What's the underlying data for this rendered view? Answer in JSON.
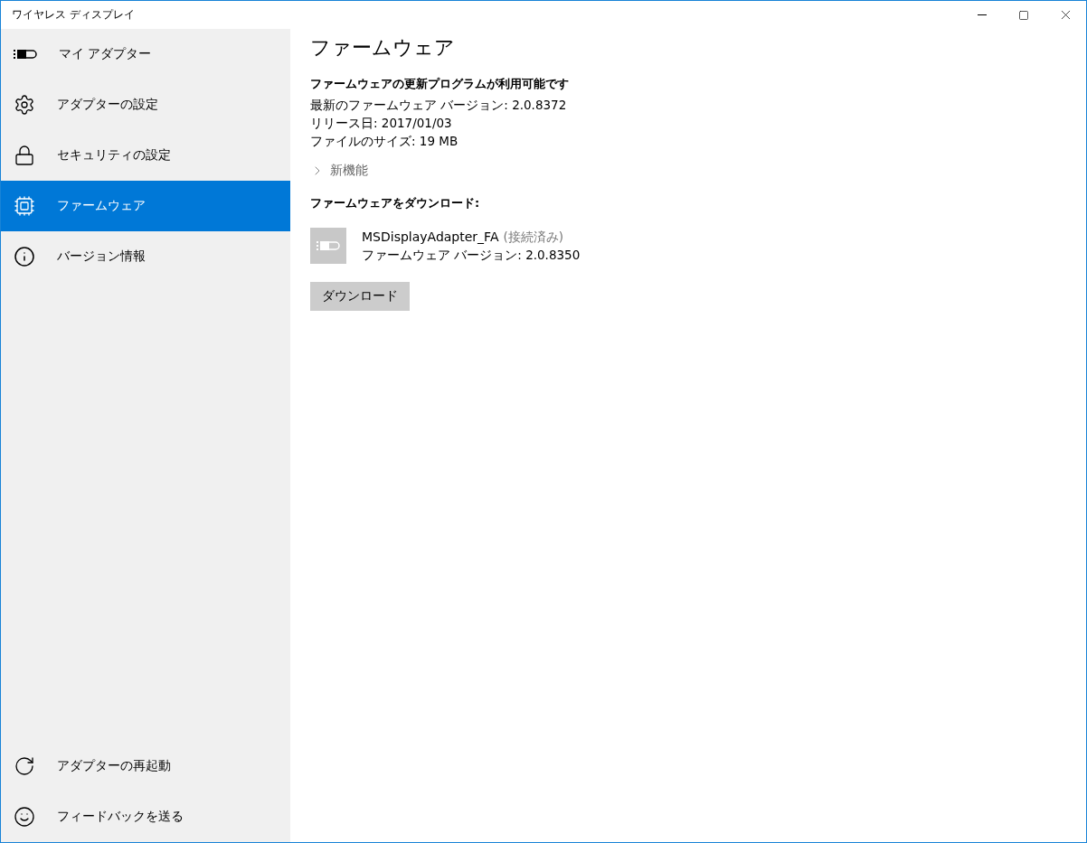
{
  "window": {
    "title": "ワイヤレス ディスプレイ"
  },
  "sidebar": {
    "items": [
      {
        "label": "マイ アダプター",
        "selected": false
      },
      {
        "label": "アダプターの設定",
        "selected": false
      },
      {
        "label": "セキュリティの設定",
        "selected": false
      },
      {
        "label": "ファームウェア",
        "selected": true
      },
      {
        "label": "バージョン情報",
        "selected": false
      }
    ],
    "footer_items": [
      {
        "label": "アダプターの再起動"
      },
      {
        "label": "フィードバックを送る"
      }
    ]
  },
  "content": {
    "title": "ファームウェア",
    "update_heading": "ファームウェアの更新プログラムが利用可能です",
    "details": [
      "最新のファームウェア バージョン:  2.0.8372",
      "リリース日: 2017/01/03",
      "ファイルのサイズ: 19 MB"
    ],
    "expander": {
      "label": "新機能",
      "expanded": false
    },
    "download_heading": "ファームウェアをダウンロード:",
    "device": {
      "name": "MSDisplayAdapter_FA",
      "status": "(接続済み)",
      "version": "ファームウェア バージョン: 2.0.8350"
    },
    "button": "ダウンロード"
  }
}
